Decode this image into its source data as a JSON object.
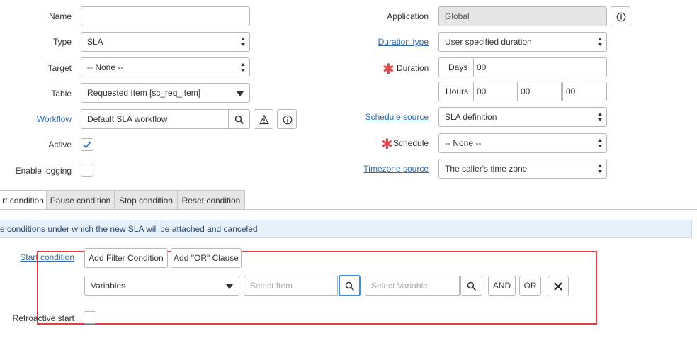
{
  "left": {
    "name_label": "Name",
    "name_value": "",
    "type_label": "Type",
    "type_value": "SLA",
    "target_label": "Target",
    "target_value": "-- None --",
    "table_label": "Table",
    "table_value": "Requested Item [sc_req_item]",
    "workflow_label": "Workflow",
    "workflow_value": "Default SLA workflow",
    "active_label": "Active",
    "active_checked": true,
    "logging_label": "Enable logging",
    "logging_checked": false
  },
  "right": {
    "application_label": "Application",
    "application_value": "Global",
    "duration_type_label": "Duration type",
    "duration_type_value": "User specified duration",
    "duration_label": "Duration",
    "days_label": "Days",
    "days_value": "00",
    "hours_label": "Hours",
    "hours_value": "00",
    "minutes_value": "00",
    "seconds_value": "00",
    "schedule_source_label": "Schedule source",
    "schedule_source_value": "SLA definition",
    "schedule_label": "Schedule",
    "schedule_value": "-- None --",
    "timezone_source_label": "Timezone source",
    "timezone_source_value": "The caller's time zone"
  },
  "tabs": [
    {
      "label": "rt condition",
      "active": true
    },
    {
      "label": "Pause condition",
      "active": false
    },
    {
      "label": "Stop condition",
      "active": false
    },
    {
      "label": "Reset condition",
      "active": false
    }
  ],
  "info_bar": "e conditions under which the new SLA will be attached and canceled",
  "condition": {
    "label": "Start condition",
    "add_filter_label": "Add Filter Condition",
    "add_or_label": "Add \"OR\" Clause",
    "field_value": "Variables",
    "select_item_placeholder": "Select Item",
    "select_variable_placeholder": "Select Variable",
    "and_label": "AND",
    "or_label": "OR"
  },
  "retroactive_label": "Retroactive start",
  "colors": {
    "link": "#2f6db5",
    "required": "#e0464a",
    "info_bg": "#e8f1fa",
    "highlight_box": "#e23c3c",
    "focus": "#3a8ee6"
  }
}
